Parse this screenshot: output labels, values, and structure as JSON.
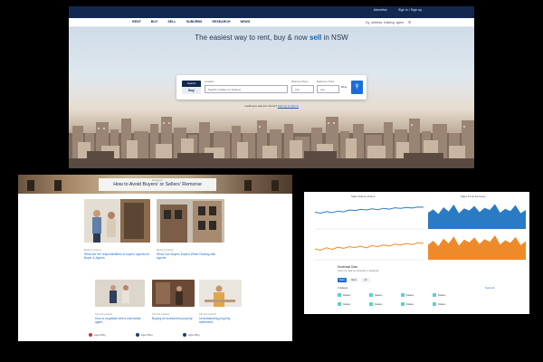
{
  "hero": {
    "topbar": {
      "advertise": "Advertise",
      "sign_in": "Sign in / Sign up"
    },
    "nav": {
      "items": [
        "RENT",
        "BUY",
        "SELL",
        "SUBURBS",
        "RESEARCH",
        "NEWS"
      ],
      "search_placeholder": "Eg. address, building, agent",
      "search_icon": "search-icon"
    },
    "tagline_prefix": "The easiest way to rent, buy & now",
    "tagline_accent": "sell",
    "tagline_suffix": "in NSW",
    "search": {
      "mode_label": "Search",
      "mode_value": "Buy",
      "location_label": "Location",
      "location_placeholder": "Search Location (i.e Sydney)",
      "min_label": "Minimum Price",
      "min_value": "Any",
      "max_label": "Maximum Price",
      "max_value": "Any",
      "more": "More",
      "go_icon": "search-icon"
    },
    "helper_text": "Looking to sell your home?",
    "helper_link": "Sign up or sign in",
    "colors": {
      "navy": "#13284f",
      "accent": "#1c5fae",
      "button": "#1c6ed4"
    }
  },
  "blog": {
    "category": "Research",
    "title": "How to Avoid Buyers' or Sellers' Remorse",
    "cards": [
      {
        "meta": "Buying a property",
        "headline": "What are the responsibilities of buyers' agents for Buyer & Agents"
      },
      {
        "meta": "Buying a property",
        "headline": "What Can Buyers Expect When Dealing with Agents"
      },
      {
        "meta": "Tips and research",
        "headline": "How to negotiate with a real estate agent"
      },
      {
        "meta": "Tips and research",
        "headline": "Buying an investment property"
      },
      {
        "meta": "Tips and research",
        "headline": "Understanding property settlement"
      }
    ],
    "footer_authors": [
      "Agent Blog",
      "Agent Blog",
      "Agent Blog"
    ]
  },
  "dashboard": {
    "panel_left_title": "Sales Volume & Rent",
    "panel_right_title": "Sales Trend Summary",
    "download_title": "Download Data",
    "download_sub": "Select the data you would like to download",
    "pills": [
      "Sales",
      "Rent",
      "All"
    ],
    "datasets_heading": "9 datasets",
    "datasets_link": "Select all",
    "datasets": [
      "Dataset",
      "Dataset",
      "Dataset",
      "Dataset",
      "Dataset",
      "Dataset",
      "Dataset",
      "Dataset"
    ]
  },
  "chart_data": [
    {
      "type": "line",
      "series": [
        {
          "color": "#2a7bc4",
          "values": [
            62,
            58,
            64,
            60,
            66,
            63,
            70,
            68,
            72,
            70,
            74,
            71,
            76,
            73,
            78,
            76,
            79,
            77,
            81,
            80
          ]
        },
        {
          "color": "#ef8a2b",
          "values": [
            40,
            35,
            44,
            38,
            46,
            42,
            48,
            45,
            50,
            44,
            52,
            48,
            55,
            50,
            58,
            54,
            60,
            56,
            62,
            60
          ]
        }
      ]
    },
    {
      "type": "area",
      "series": [
        {
          "color": "#2a7bc4",
          "values": [
            60,
            72,
            55,
            80,
            64,
            90,
            58,
            76,
            68,
            85,
            62,
            78,
            70,
            92,
            60,
            74,
            66,
            88,
            58,
            70
          ]
        },
        {
          "color": "#ef8a2b",
          "values": [
            55,
            70,
            50,
            78,
            60,
            86,
            52,
            74,
            64,
            82,
            58,
            76,
            66,
            90,
            56,
            72,
            62,
            84,
            54,
            68
          ]
        }
      ]
    }
  ]
}
